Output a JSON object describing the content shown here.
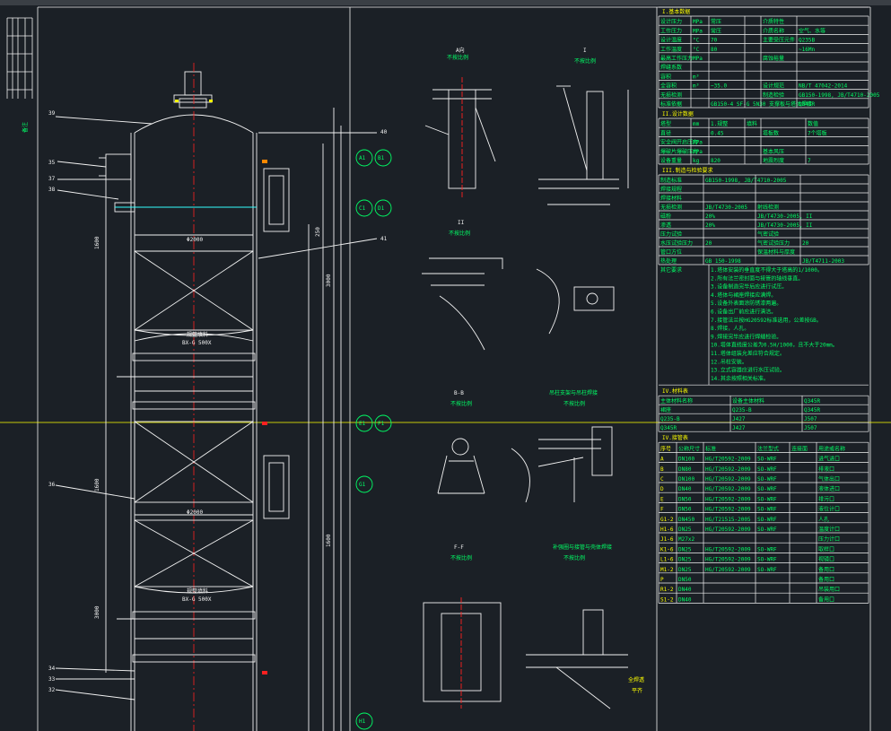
{
  "colors": {
    "background": "#1b2026",
    "line": "#f2f2f2",
    "accent_red": "#ff2020",
    "accent_yellow": "#ffff00",
    "accent_green": "#00ff66",
    "accent_cyan": "#33ffff"
  },
  "tower": {
    "dimension_labels": [
      "Φ2000",
      "Φ2000"
    ],
    "packing_labels": [
      "规整填料",
      "BX-G 500X",
      "规整填料",
      "BX-G 500X"
    ],
    "part_numbers": [
      "39",
      "35",
      "37",
      "38",
      "36",
      "34",
      "33",
      "32",
      "40",
      "41"
    ],
    "side_dims": [
      "1600",
      "1600",
      "3000",
      "3000",
      "250",
      "1600"
    ]
  },
  "views": {
    "a": {
      "title": "A向",
      "subtitle": "不按比例"
    },
    "i": {
      "title": "I",
      "subtitle": "不按比例"
    },
    "ii": {
      "title": "II",
      "subtitle": "不按比例"
    },
    "bb": {
      "title": "B-B",
      "subtitle": "不按比例"
    },
    "support": {
      "title": "吊柱支架与吊柱焊接",
      "subtitle": "不按比例"
    },
    "ff": {
      "title": "F-F",
      "subtitle": "不按比例"
    },
    "weld": {
      "title": "补强圈与接管与壳体焊接",
      "subtitle": "不按比例"
    },
    "weld_note": [
      "全焊透",
      "平齐"
    ]
  },
  "table1": {
    "title": "I.基本数据",
    "head": [
      "",
      "",
      "壳程",
      "",
      "",
      "管程"
    ],
    "rows": [
      [
        "设计压力",
        "MPa",
        "常压",
        "",
        "介质特性",
        ""
      ],
      [
        "工作压力",
        "MPa",
        "常压",
        "",
        "介质名称",
        "空气、水等"
      ],
      [
        "设计温度",
        "°C",
        "70",
        "",
        "主要受压元件",
        "Q235B"
      ],
      [
        "工作温度",
        "°C",
        "80",
        "",
        "",
        "~16Mn"
      ],
      [
        "最高工作压力",
        "MPa",
        "",
        "",
        "腐蚀裕量",
        ""
      ],
      [
        "焊缝系数",
        "",
        "",
        "",
        "",
        ""
      ],
      [
        "容积",
        "m³",
        "",
        "",
        "",
        ""
      ],
      [
        "全容积",
        "m³",
        "~35.0",
        "",
        "设计规范",
        "NB/T 47042-2014"
      ],
      [
        "无损检测",
        "",
        "",
        "",
        "制造检验",
        "GB150-1998, JB/T4710-2005"
      ],
      [
        "标准依据",
        "",
        "GB150-4 SF-G 5N30 支撑板与塔体焊接",
        "",
        "",
        "Q345R"
      ]
    ]
  },
  "table2": {
    "title": "II.设计数据",
    "rows": [
      [
        "塔型",
        "mm",
        "1.规整",
        "填料",
        "",
        "数值"
      ],
      [
        "直径",
        "",
        "0.45",
        "",
        "塔板数",
        "7个塔板"
      ],
      [
        "安全阀开启压力",
        "MPa",
        "",
        "",
        "",
        ""
      ],
      [
        "爆破片爆破压力",
        "MPa",
        "",
        "",
        "基本风压",
        ""
      ],
      [
        "设备重量",
        "kg",
        "820",
        "",
        "地震烈度",
        "7"
      ]
    ]
  },
  "table3": {
    "title": "III.制造与检验要求",
    "rows": [
      [
        "制造标准",
        "GB150-1998, JB/T4710-2005"
      ],
      [
        "焊接规程",
        ""
      ],
      [
        "焊接材料",
        ""
      ],
      [
        "无损检测",
        "JB/T4730-2005",
        "射线检测",
        ""
      ],
      [
        "磁粉",
        "20%",
        "JB/T4730-2005, II"
      ],
      [
        "渗透",
        "20%",
        "JB/T4730-2005, II"
      ],
      [
        "压力试验",
        "",
        "气密试验",
        ""
      ],
      [
        "水压试验压力",
        "20",
        "气密试验压力",
        "20"
      ],
      [
        "管口方位",
        "",
        "保温材料与厚度",
        ""
      ],
      [
        "热处理",
        "GB 150-1998",
        "",
        "JB/T4711-2003"
      ]
    ],
    "notes_title": "其它要求",
    "notes": [
      "1.塔体安装的垂直度不得大于塔高的1/1000。",
      "2.所有法兰密封面与接管的轴线垂直。",
      "3.设备制造完毕后应进行试压。",
      "4.塔体与裙座焊接应满焊。",
      "5.设备外表面涂防锈漆两遍。",
      "6.设备出厂前应进行清洁。",
      "7.接管法兰按HG20592标准选用，公差按GB。",
      "8.焊接，人孔。",
      "9.焊接完毕应进行焊缝检验。",
      "10.塔体直线度公差为0.5H/1000，且不大于20mm。",
      "11.塔体组装允差应符合规定。",
      "12.吊柱安装。",
      "13.立式容器应进行水压试验。",
      "14.其余按照相关标准。"
    ]
  },
  "table4": {
    "title": "IV.接管表",
    "rows": [
      [
        "序号",
        "公称尺寸",
        "标准",
        "法兰型式",
        "连接面",
        "用途或名称"
      ],
      [
        "A",
        "DN100",
        "HG/T20592-2009",
        "SO-WRF",
        "",
        "进气进口"
      ],
      [
        "B",
        "DN80",
        "HG/T20592-2009",
        "SO-WRF",
        "",
        "排液口"
      ],
      [
        "C",
        "DN100",
        "HG/T20592-2009",
        "SO-WRF",
        "",
        "气体出口"
      ],
      [
        "D",
        "DN40",
        "HG/T20592-2009",
        "SO-WRF",
        "",
        "液体进口"
      ],
      [
        "E",
        "DN50",
        "HG/T20592-2009",
        "SO-WRF",
        "",
        "排污口"
      ],
      [
        "F",
        "DN50",
        "HG/T20592-2009",
        "SO-WRF",
        "",
        "液位计口"
      ],
      [
        "G1-2",
        "DN450",
        "HG/T21515-2005",
        "SO-WRF",
        "",
        "人孔"
      ],
      [
        "H1-6",
        "DN25",
        "HG/T20592-2009",
        "SO-WRF",
        "",
        "温度计口"
      ],
      [
        "J1-6",
        "M27x2",
        "",
        "",
        "",
        "压力计口"
      ],
      [
        "K1-6",
        "DN25",
        "HG/T20592-2009",
        "SO-WRF",
        "",
        "取样口"
      ],
      [
        "L1-6",
        "DN25",
        "HG/T20592-2009",
        "SO-WRF",
        "",
        "视镜口"
      ],
      [
        "M1-2",
        "DN25",
        "HG/T20592-2009",
        "SO-WRF",
        "",
        "备用口"
      ],
      [
        "P",
        "DN50",
        "",
        "",
        "",
        "备用口"
      ],
      [
        "R1-2",
        "DN40",
        "",
        "",
        "",
        "吊装用口"
      ],
      [
        "S1-2",
        "DN40",
        "",
        "",
        "",
        "备用口"
      ]
    ]
  },
  "table5": {
    "title": "IV.材料表",
    "rows": [
      [
        "主体材料名称",
        "设备主体材料",
        "Q345R"
      ],
      [
        "裙座",
        "Q235-B",
        "Q345R"
      ],
      [
        "Q235-B",
        "J427",
        "J507"
      ],
      [
        "Q345R",
        "J427",
        "J507"
      ]
    ]
  },
  "balloons": [
    "A1",
    "B1",
    "C1",
    "D1",
    "E1",
    "F1",
    "G1",
    "H1"
  ]
}
